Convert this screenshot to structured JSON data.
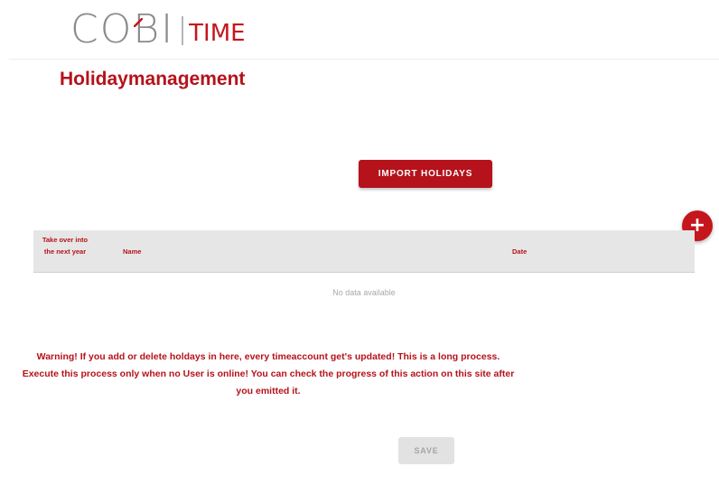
{
  "header": {
    "logo_main": "COBI",
    "logo_sub": "TIME"
  },
  "page": {
    "title": "Holidaymanagement"
  },
  "actions": {
    "import_label": "IMPORT HOLIDAYS",
    "add_icon": "plus-icon",
    "save_label": "SAVE"
  },
  "table": {
    "columns": {
      "takeover": "Take over into the next year",
      "name": "Name",
      "date": "Date"
    },
    "empty_text": "No data available"
  },
  "warning": "Warning! If you add or delete holdays in here, every timeaccount get's updated! This is a long process. Execute this process only when no User is online! You can check the progress of this action on this site after you emitted it.",
  "colors": {
    "brand_red": "#b5121b",
    "logo_gray": "#8a8a8a"
  }
}
